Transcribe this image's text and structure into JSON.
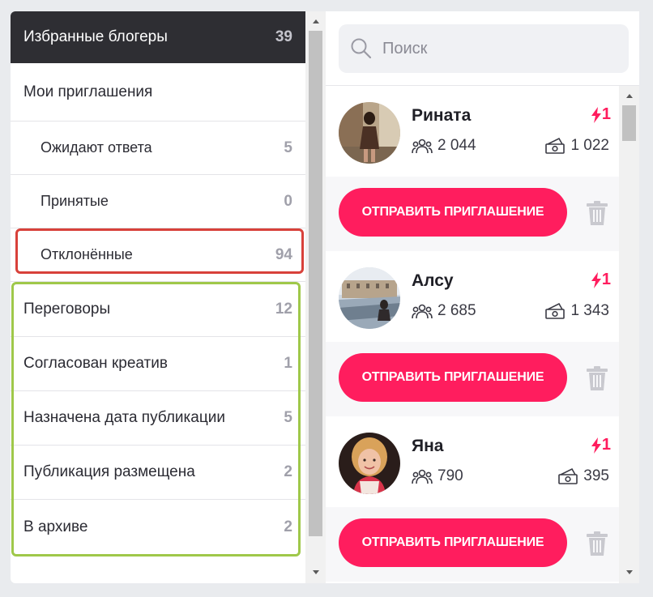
{
  "sidebar": {
    "header": {
      "label": "Избранные блогеры",
      "count": "39"
    },
    "invitations": {
      "label": "Мои приглашения"
    },
    "invitation_items": [
      {
        "label": "Ожидают ответа",
        "count": "5"
      },
      {
        "label": "Принятые",
        "count": "0"
      },
      {
        "label": "Отклонённые",
        "count": "94"
      }
    ],
    "stages": [
      {
        "label": "Переговоры",
        "count": "12"
      },
      {
        "label": "Согласован креатив",
        "count": "1"
      },
      {
        "label": "Назначена дата публикации",
        "count": "5"
      },
      {
        "label": "Публикация размещена",
        "count": "2"
      },
      {
        "label": "В архиве",
        "count": "2"
      }
    ]
  },
  "search": {
    "placeholder": "Поиск",
    "icon": "search-icon"
  },
  "bloggers": [
    {
      "name": "Рината",
      "badge": "1",
      "followers": "2 044",
      "price": "1 022",
      "button": "ОТПРАВИТЬ ПРИГЛАШЕНИЕ"
    },
    {
      "name": "Алсу",
      "badge": "1",
      "followers": "2 685",
      "price": "1 343",
      "button": "ОТПРАВИТЬ ПРИГЛАШЕНИЕ"
    },
    {
      "name": "Яна",
      "badge": "1",
      "followers": "790",
      "price": "395",
      "button": "ОТПРАВИТЬ ПРИГЛАШЕНИЕ"
    }
  ],
  "colors": {
    "accent": "#ff1d5e",
    "header_bg": "#2e2e33",
    "highlight_red": "#d8413a",
    "highlight_green": "#9fc84a"
  }
}
